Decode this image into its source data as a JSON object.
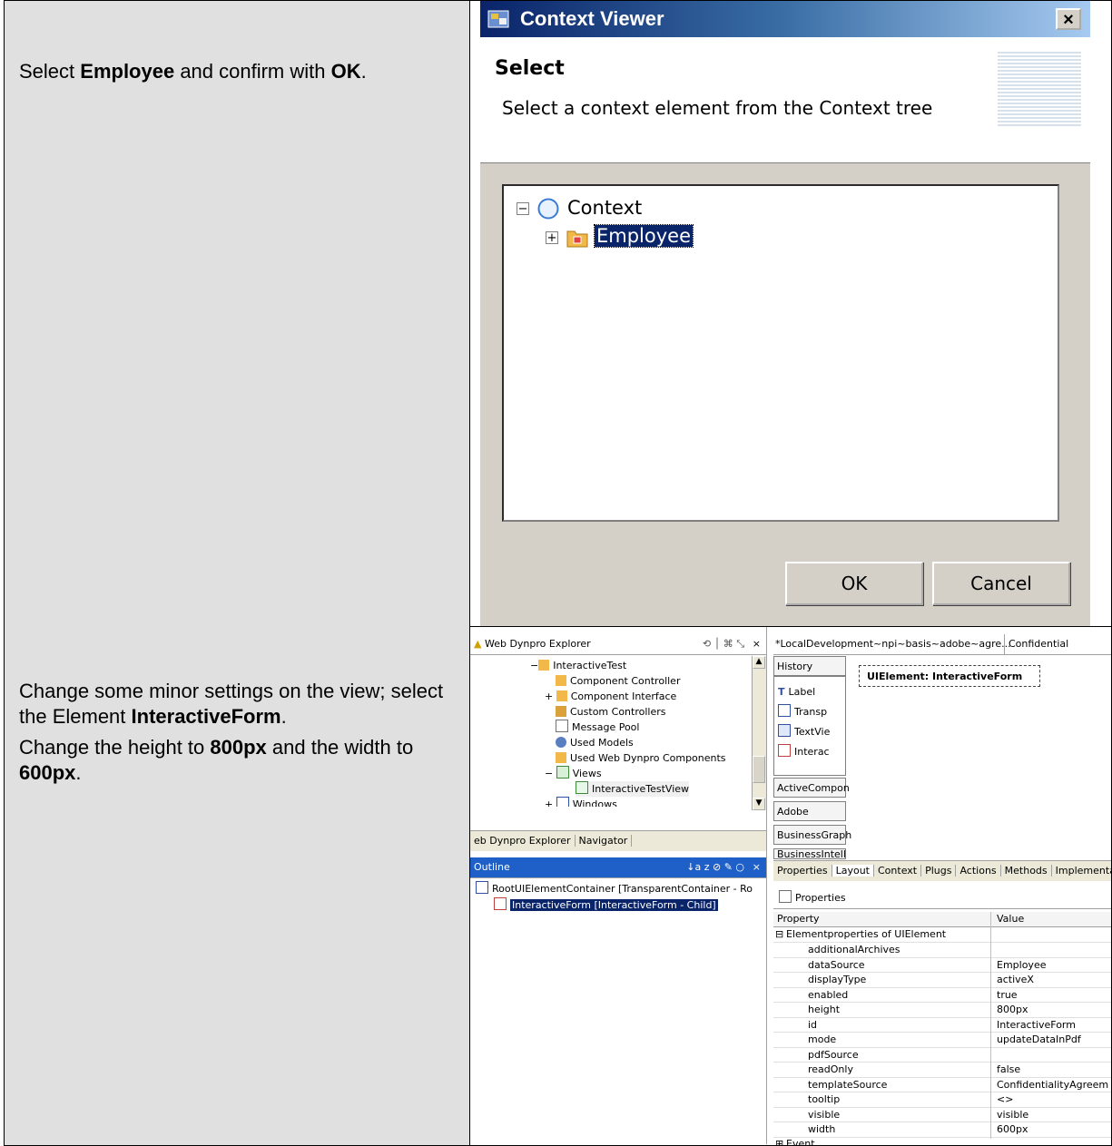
{
  "rows": [
    {
      "instructions": [
        {
          "pre": "Select ",
          "b1": "Employee",
          "mid": " and confirm with ",
          "b2": "OK",
          "post": "."
        }
      ]
    },
    {
      "instructions": [
        {
          "pre": "Change some minor settings on the view; select the Element ",
          "b1": "InteractiveForm",
          "mid": ".",
          "b2": "",
          "post": ""
        },
        {
          "pre": "Change the height to ",
          "b1": "800px",
          "mid": " and the width to ",
          "b2": "600px",
          "post": "."
        }
      ]
    }
  ],
  "dialog": {
    "title": "Context Viewer",
    "close": "×",
    "header_title": "Select",
    "header_desc": "Select a context element from the Context tree",
    "tree": [
      {
        "label": "Context",
        "expander": "−",
        "icon": "context-node-icon"
      },
      {
        "label": "Employee",
        "expander": "+",
        "icon": "node-folder-icon",
        "selected": true
      }
    ],
    "ok": "OK",
    "cancel": "Cancel"
  },
  "eclipse": {
    "explorer_title": "Web Dynpro Explorer",
    "explorer_tree": [
      {
        "label": "InteractiveTest",
        "indent": 1,
        "exp": "−"
      },
      {
        "label": "Component Controller",
        "indent": 2,
        "exp": ""
      },
      {
        "label": "Component Interface",
        "indent": 2,
        "exp": "+"
      },
      {
        "label": "Custom Controllers",
        "indent": 2,
        "exp": ""
      },
      {
        "label": "Message Pool",
        "indent": 2,
        "exp": ""
      },
      {
        "label": "Used Models",
        "indent": 2,
        "exp": ""
      },
      {
        "label": "Used Web Dynpro Components",
        "indent": 2,
        "exp": ""
      },
      {
        "label": "Views",
        "indent": 2,
        "exp": "−"
      },
      {
        "label": "InteractiveTestView",
        "indent": 3,
        "exp": "",
        "selected": true
      },
      {
        "label": "Windows",
        "indent": 2,
        "exp": "+"
      }
    ],
    "explorer_tabs": [
      "eb Dynpro Explorer",
      "Navigator"
    ],
    "outline_title": "Outline",
    "outline_tree": [
      {
        "label": "RootUIElementContainer [TransparentContainer - Ro",
        "indent": 0
      },
      {
        "label": "InteractiveForm [InteractiveForm - Child]",
        "indent": 1,
        "selected": true
      }
    ],
    "editor_tab1": "*LocalDevelopment~npi~basis~adobe~agre...",
    "editor_tab2": "Confidential",
    "palette_history": "History",
    "palette_items": [
      "Label",
      "Transp",
      "TextVie",
      "Interac"
    ],
    "palette_groups": [
      "ActiveCompon",
      "Adobe",
      "BusinessGraph",
      "BusinessIntellig"
    ],
    "ui_element_label": "UIElement: InteractiveForm",
    "editor_tabs": [
      "Properties",
      "Layout",
      "Context",
      "Plugs",
      "Actions",
      "Methods",
      "Implemental"
    ],
    "props_title": "Properties",
    "props_header": [
      "Property",
      "Value"
    ],
    "props_group": "Elementproperties of UIElement",
    "props": [
      [
        "additionalArchives",
        ""
      ],
      [
        "dataSource",
        "Employee"
      ],
      [
        "displayType",
        "activeX"
      ],
      [
        "enabled",
        "true"
      ],
      [
        "height",
        "800px"
      ],
      [
        "id",
        "InteractiveForm"
      ],
      [
        "mode",
        "updateDataInPdf"
      ],
      [
        "pdfSource",
        ""
      ],
      [
        "readOnly",
        "false"
      ],
      [
        "templateSource",
        "ConfidentialityAgreem"
      ],
      [
        "tooltip",
        "<>"
      ],
      [
        "visible",
        "visible"
      ],
      [
        "width",
        "600px"
      ]
    ],
    "props_group2": "Event"
  }
}
